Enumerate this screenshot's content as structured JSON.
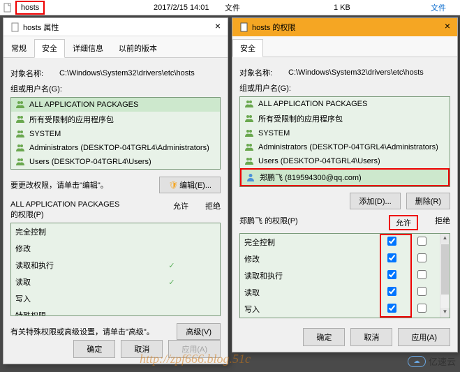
{
  "explorer": {
    "filename": "hosts",
    "date": "2017/2/15 14:01",
    "type": "文件",
    "size": "1 KB",
    "file_link": "文件"
  },
  "left": {
    "title": "hosts 属性",
    "tabs": [
      "常规",
      "安全",
      "详细信息",
      "以前的版本"
    ],
    "active_tab": 1,
    "object_label": "对象名称:",
    "object_path": "C:\\Windows\\System32\\drivers\\etc\\hosts",
    "group_label": "组或用户名(G):",
    "groups": [
      {
        "icon": "group",
        "name": "ALL APPLICATION PACKAGES"
      },
      {
        "icon": "group",
        "name": "所有受限制的应用程序包"
      },
      {
        "icon": "group",
        "name": "SYSTEM"
      },
      {
        "icon": "group",
        "name": "Administrators (DESKTOP-04TGRL4\\Administrators)"
      },
      {
        "icon": "group",
        "name": "Users (DESKTOP-04TGRL4\\Users)"
      }
    ],
    "edit_text": "要更改权限，请单击\"编辑\"。",
    "edit_btn": "编辑(E)...",
    "perm_header": "ALL APPLICATION PACKAGES\n的权限(P)",
    "allow_col": "允许",
    "deny_col": "拒绝",
    "perms": [
      {
        "name": "完全控制",
        "allow": false,
        "deny": false
      },
      {
        "name": "修改",
        "allow": false,
        "deny": false
      },
      {
        "name": "读取和执行",
        "allow": true,
        "deny": false
      },
      {
        "name": "读取",
        "allow": true,
        "deny": false
      },
      {
        "name": "写入",
        "allow": false,
        "deny": false
      },
      {
        "name": "特殊权限",
        "allow": false,
        "deny": false
      }
    ],
    "advanced_text": "有关特殊权限或高级设置，请单击\"高级\"。",
    "advanced_btn": "高级(V)",
    "ok": "确定",
    "cancel": "取消",
    "apply": "应用(A)"
  },
  "right": {
    "title": "hosts 的权限",
    "tab": "安全",
    "object_label": "对象名称:",
    "object_path": "C:\\Windows\\System32\\drivers\\etc\\hosts",
    "group_label": "组或用户名(G):",
    "groups": [
      {
        "icon": "group",
        "name": "ALL APPLICATION PACKAGES"
      },
      {
        "icon": "group",
        "name": "所有受限制的应用程序包"
      },
      {
        "icon": "group",
        "name": "SYSTEM"
      },
      {
        "icon": "group",
        "name": "Administrators (DESKTOP-04TGRL4\\Administrators)"
      },
      {
        "icon": "group",
        "name": "Users (DESKTOP-04TGRL4\\Users)"
      },
      {
        "icon": "user",
        "name": "郑鹏飞 (819594300@qq.com)"
      }
    ],
    "selected_group": 5,
    "add_btn": "添加(D)...",
    "remove_btn": "删除(R)",
    "perm_header": "郑鹏飞 的权限(P)",
    "allow_col": "允许",
    "deny_col": "拒绝",
    "perms": [
      {
        "name": "完全控制",
        "allow": true,
        "deny": false
      },
      {
        "name": "修改",
        "allow": true,
        "deny": false
      },
      {
        "name": "读取和执行",
        "allow": true,
        "deny": false
      },
      {
        "name": "读取",
        "allow": true,
        "deny": false
      },
      {
        "name": "写入",
        "allow": true,
        "deny": false
      }
    ],
    "ok": "确定",
    "cancel": "取消",
    "apply": "应用(A)"
  },
  "watermark": "http://zpf666.blog.51c",
  "brand": "亿速云"
}
